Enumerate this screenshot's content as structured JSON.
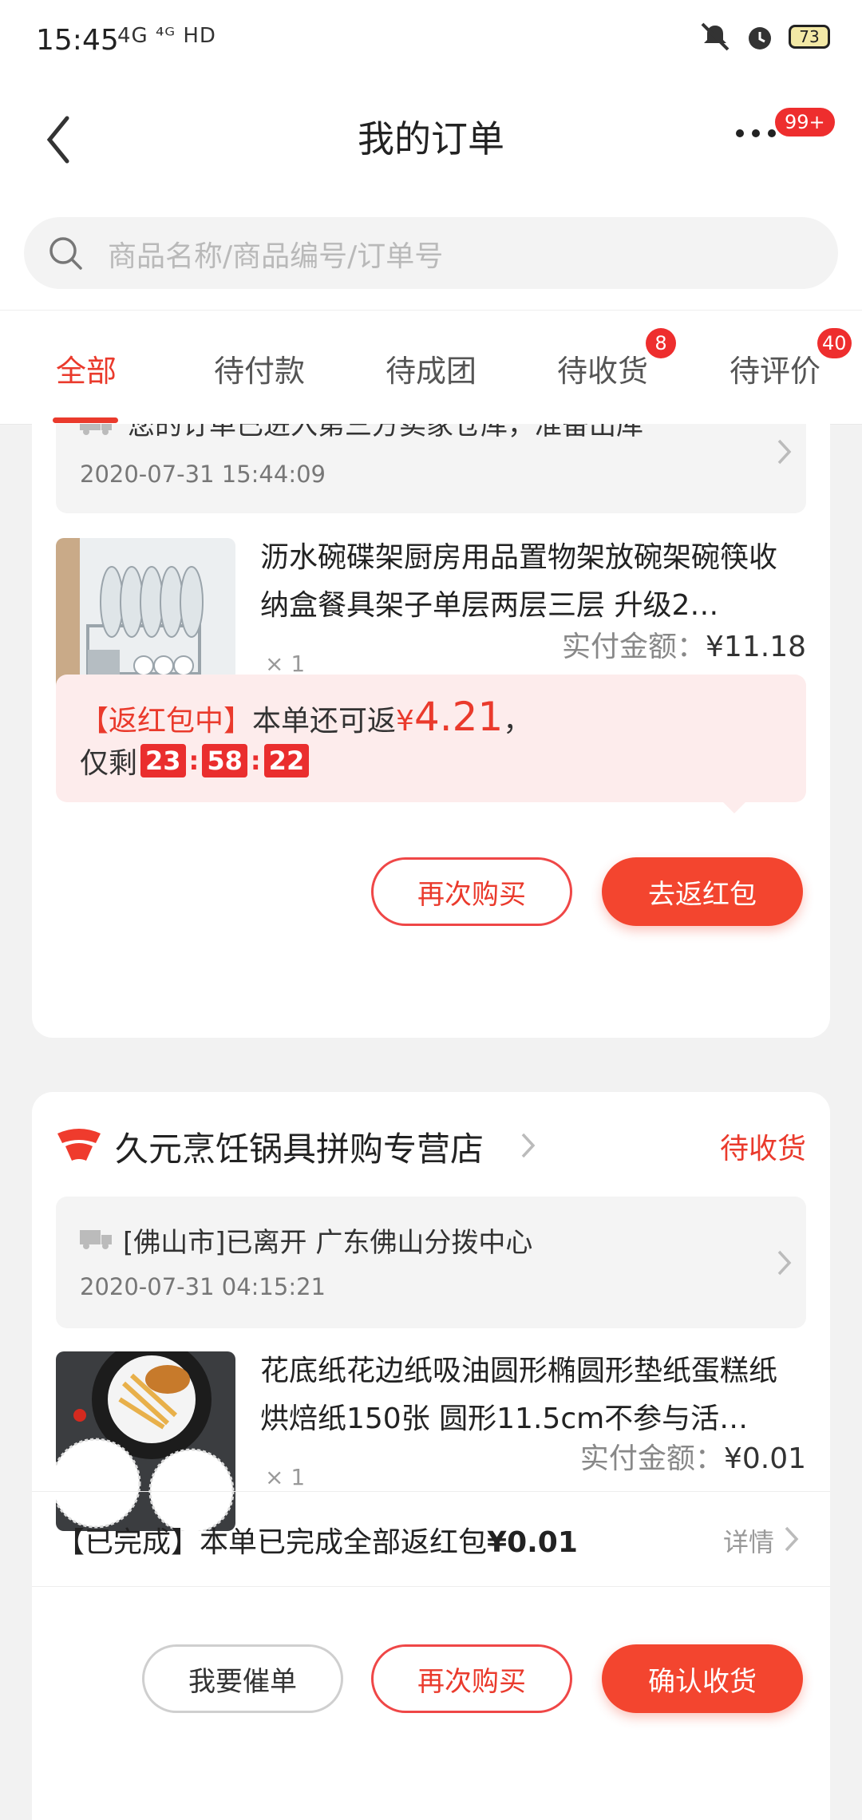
{
  "status_bar": {
    "time": "15:45",
    "network": "4G ⁴ᴳ HD",
    "battery": "73"
  },
  "header": {
    "title": "我的订单",
    "badge": "99+"
  },
  "search": {
    "placeholder": "商品名称/商品编号/订单号"
  },
  "tabs": [
    {
      "label": "全部",
      "badge": ""
    },
    {
      "label": "待付款",
      "badge": ""
    },
    {
      "label": "待成团",
      "badge": ""
    },
    {
      "label": "待收货",
      "badge": "8"
    },
    {
      "label": "待评价",
      "badge": "40"
    }
  ],
  "orders": [
    {
      "logistics_text": "您的订单已进入第三方卖家仓库，准备出库",
      "logistics_time": "2020-07-31 15:44:09",
      "product_title": "沥水碗碟架厨房用品置物架放碗架碗筷收纳盒餐具架子单层两层三层 升级2…",
      "quantity": "× 1",
      "paid_label": "实付金额：",
      "paid_amount": "¥11.18",
      "redpack": {
        "tag": "【返红包中】",
        "text": "本单还可返",
        "currency": "¥",
        "amount": "4.21",
        "suffix": "，",
        "remain_label": "仅剩",
        "hh": "23",
        "mm": "58",
        "ss": "22"
      },
      "buttons": {
        "rebuy": "再次购买",
        "get_redpack": "去返红包"
      }
    },
    {
      "store_name": "久元烹饪锅具拼购专营店",
      "status": "待收货",
      "logistics_text": "[佛山市]已离开 广东佛山分拨中心",
      "logistics_time": "2020-07-31 04:15:21",
      "product_title": "花底纸花边纸吸油圆形椭圆形垫纸蛋糕纸烘焙纸150张 圆形11.5cm不参与活…",
      "quantity": "× 1",
      "paid_label": "实付金额：",
      "paid_amount": "¥0.01",
      "done_tag": "【已完成】",
      "done_text": "本单已完成全部返红包",
      "done_amount": "¥0.01",
      "detail_label": "详情",
      "buttons": {
        "urge": "我要催单",
        "rebuy": "再次购买",
        "confirm": "确认收货"
      }
    }
  ],
  "colors": {
    "accent": "#ea3a2c",
    "page_bg": "#f2f2f2"
  }
}
